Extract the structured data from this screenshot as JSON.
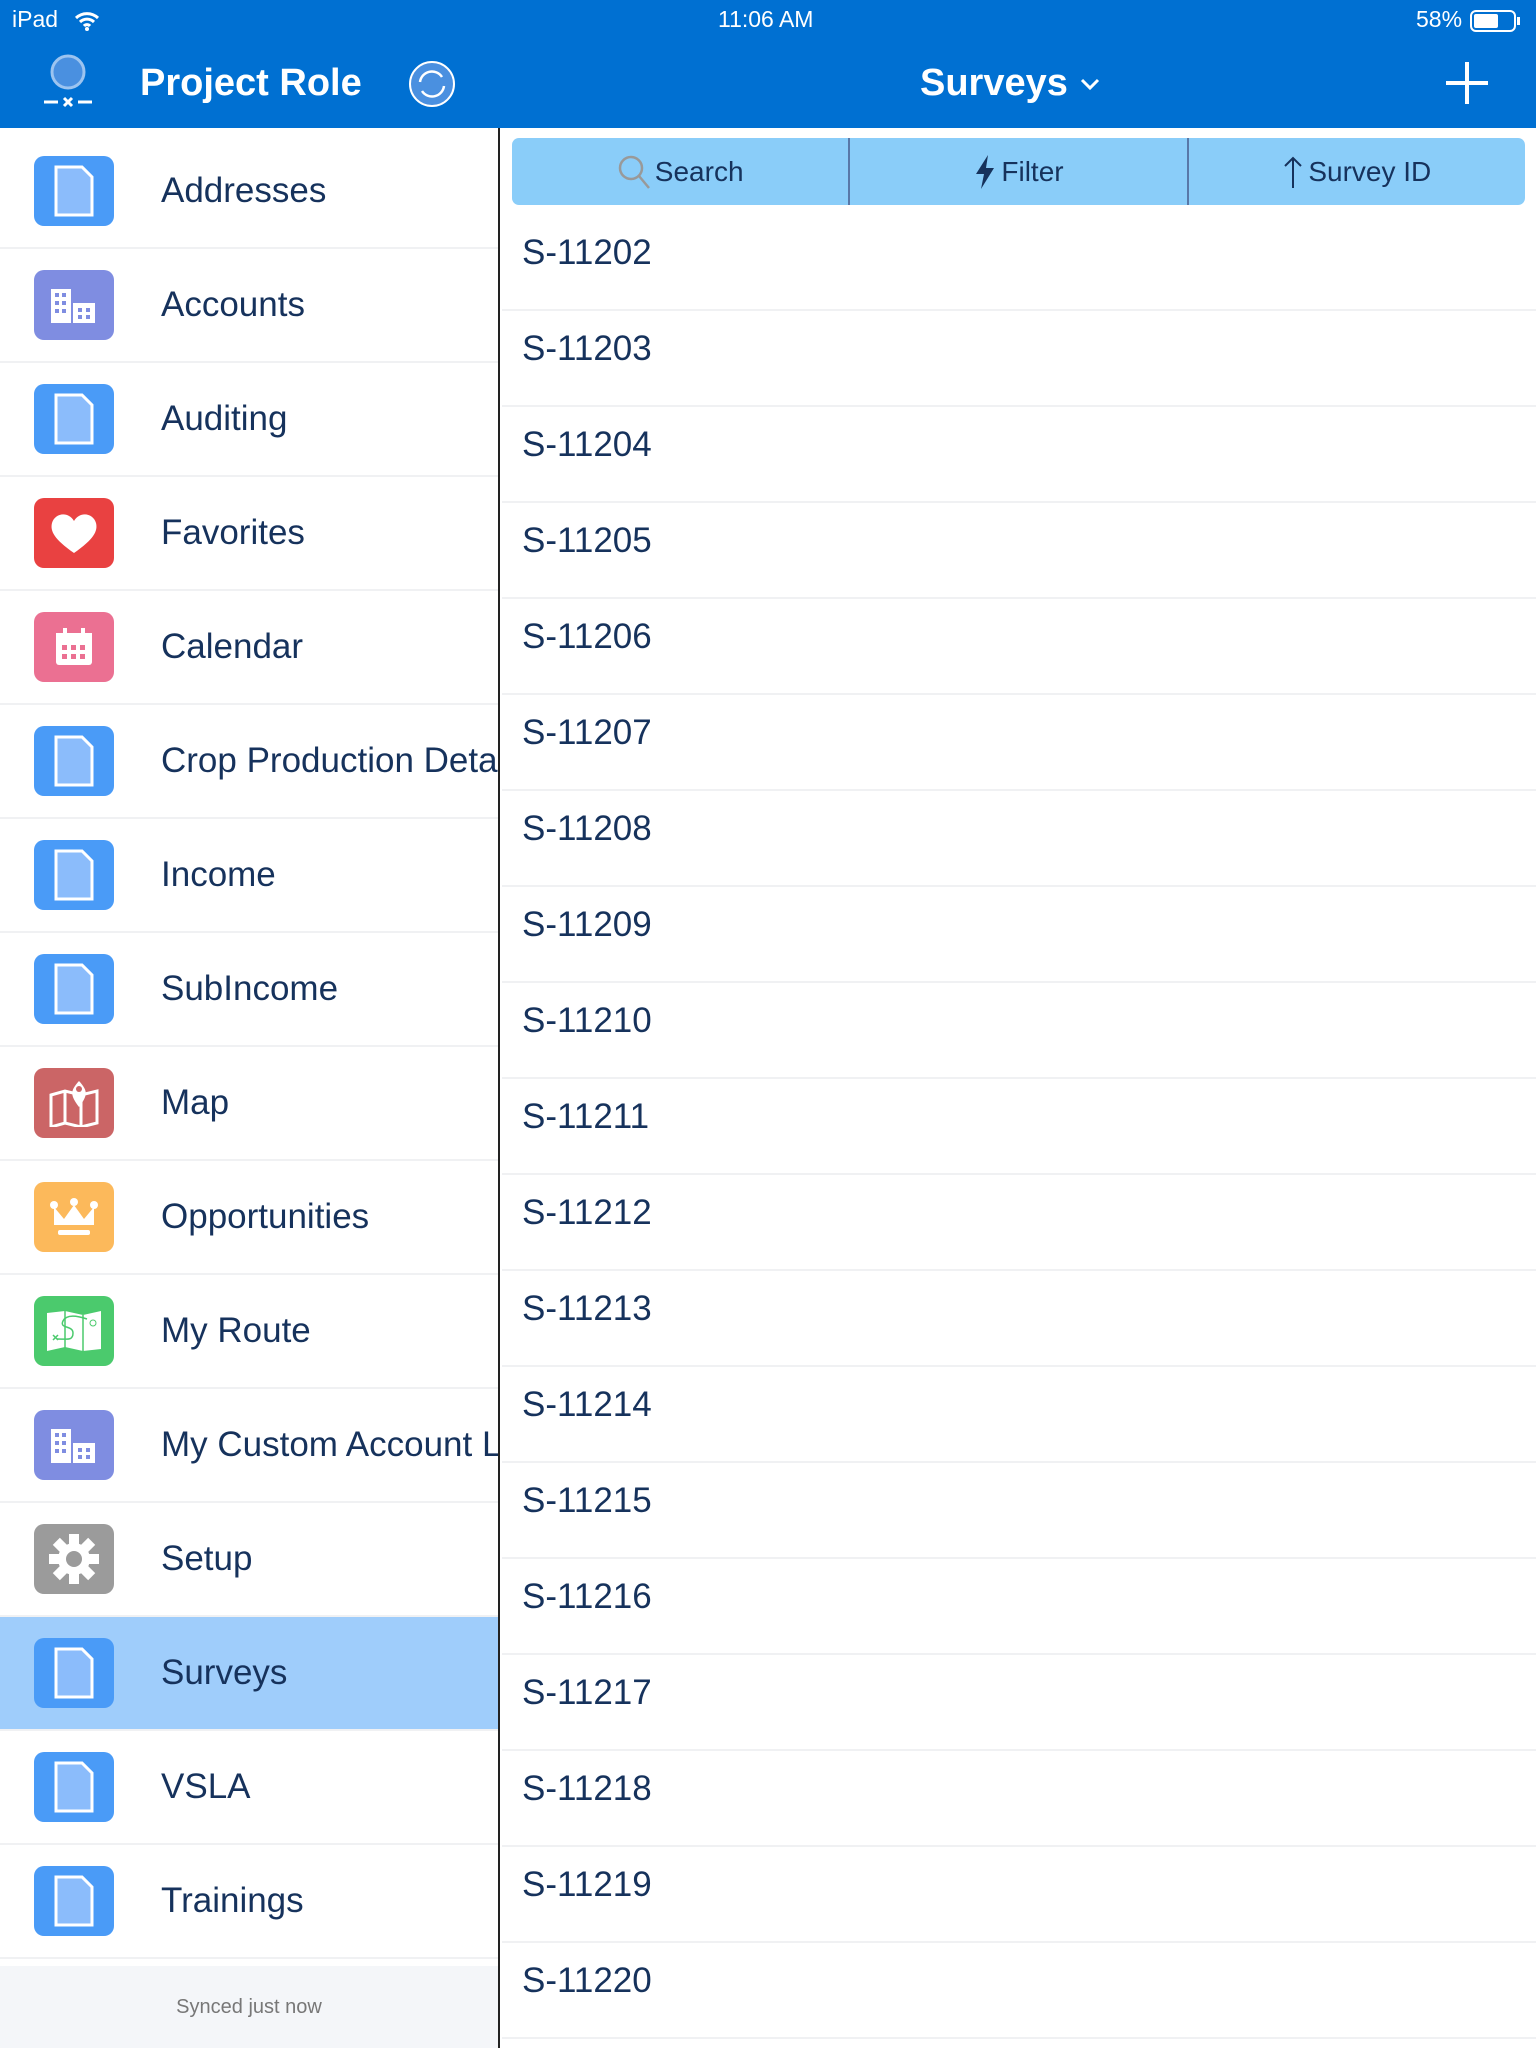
{
  "status_bar": {
    "device": "iPad",
    "time": "11:06 AM",
    "battery": "58%"
  },
  "header": {
    "app_title": "Project Role",
    "view_title": "Surveys",
    "accent": "#0070d2"
  },
  "sidebar": {
    "items": [
      {
        "label": "Addresses",
        "icon": "document-icon",
        "color": "#4a9bf7"
      },
      {
        "label": "Accounts",
        "icon": "building-icon",
        "color": "#7f8de1"
      },
      {
        "label": "Auditing",
        "icon": "document-icon",
        "color": "#4a9bf7"
      },
      {
        "label": "Favorites",
        "icon": "heart-icon",
        "color": "#e94141"
      },
      {
        "label": "Calendar",
        "icon": "calendar-icon",
        "color": "#eb7092"
      },
      {
        "label": "Crop Production Details",
        "icon": "document-icon",
        "color": "#4a9bf7"
      },
      {
        "label": "Income",
        "icon": "document-icon",
        "color": "#4a9bf7"
      },
      {
        "label": "SubIncome",
        "icon": "document-icon",
        "color": "#4a9bf7"
      },
      {
        "label": "Map",
        "icon": "map-icon",
        "color": "#cb6566"
      },
      {
        "label": "Opportunities",
        "icon": "crown-icon",
        "color": "#fcb95b"
      },
      {
        "label": "My Route",
        "icon": "route-icon",
        "color": "#4bca6d"
      },
      {
        "label": "My Custom Account List",
        "icon": "building-icon",
        "color": "#7f8de1"
      },
      {
        "label": "Setup",
        "icon": "gear-icon",
        "color": "#9b9b9b"
      },
      {
        "label": "Surveys",
        "icon": "document-icon",
        "color": "#4a9bf7",
        "selected": true
      },
      {
        "label": "VSLA",
        "icon": "document-icon",
        "color": "#4a9bf7"
      },
      {
        "label": "Trainings",
        "icon": "document-icon",
        "color": "#4a9bf7"
      }
    ],
    "footer": "Synced just now"
  },
  "toolbar": {
    "search": "Search",
    "filter": "Filter",
    "sort": "Survey ID"
  },
  "list": [
    "S-11202",
    "S-11203",
    "S-11204",
    "S-11205",
    "S-11206",
    "S-11207",
    "S-11208",
    "S-11209",
    "S-11210",
    "S-11211",
    "S-11212",
    "S-11213",
    "S-11214",
    "S-11215",
    "S-11216",
    "S-11217",
    "S-11218",
    "S-11219",
    "S-11220"
  ]
}
